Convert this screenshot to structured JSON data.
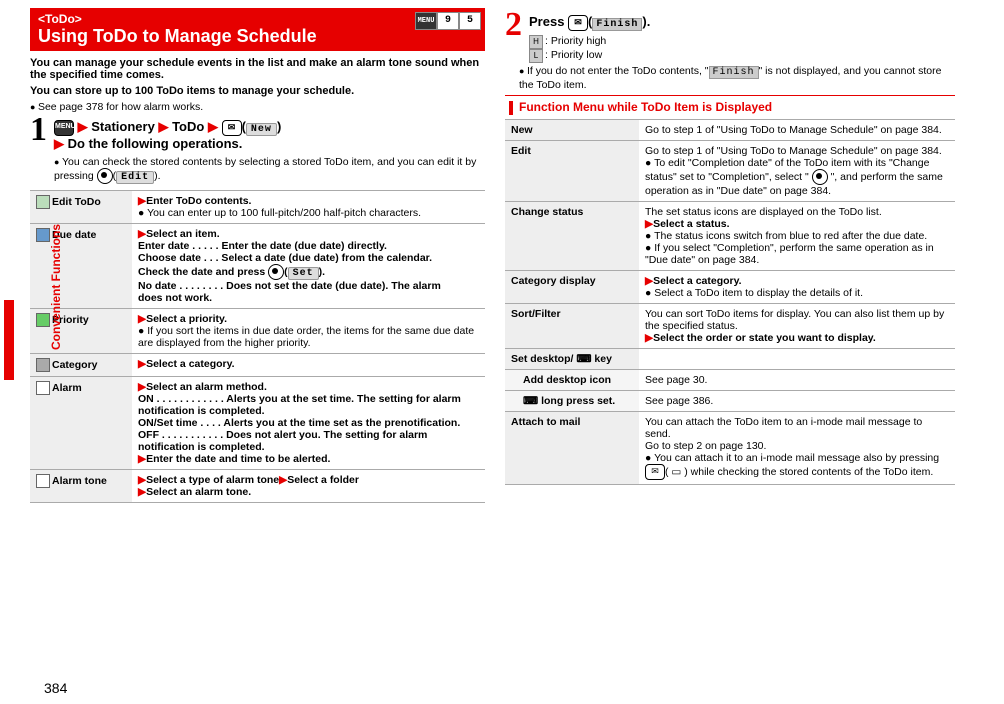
{
  "pageNumber": "384",
  "sideTab": "Convenient Functions",
  "header": {
    "kicker": "<ToDo>",
    "title": "Using ToDo to Manage Schedule",
    "badges": [
      "MENU",
      "9",
      "5"
    ]
  },
  "lead": [
    "You can manage your schedule events in the list and make an alarm tone sound when the specified time comes.",
    "You can store up to 100 ToDo items to manage your schedule."
  ],
  "leadBullet": "See page 378 for how alarm works.",
  "step1": {
    "num": "1",
    "parts": [
      "Stationery",
      "ToDo"
    ],
    "menuIcon": "MENU",
    "mailIcon": "✉",
    "newLabel": " New ",
    "end": "Do the following operations.",
    "note": "You can check the stored contents by selecting a stored ToDo item, and you can edit it by pressing ",
    "editLabel": " Edit "
  },
  "props": [
    {
      "key": "Edit ToDo",
      "iconBg": "#bdb",
      "body": "▶Enter ToDo contents.\n● You can enter up to 100 full-pitch/200 half-pitch characters."
    },
    {
      "key": "Due date",
      "iconBg": "#69c",
      "body": "▶Select an item.\nEnter date  . . . . . Enter the date (due date) directly.\nChoose date  . . . Select a date (due date) from the calendar.\n                             Check the date and press ⬤( Set ).\nNo date . . . . . . . . Does not set the date (due date). The alarm\n                             does not work."
    },
    {
      "key": "Priority",
      "iconBg": "#6c6",
      "body": "▶Select a priority.\n● If you sort the items in due date order, the items for the same due date are displayed from the higher priority."
    },
    {
      "key": "Category",
      "iconBg": "#aaa",
      "body": "▶Select a category."
    },
    {
      "key": "Alarm",
      "iconBg": "#fff",
      "body": "▶Select an alarm method.\nON . . . . . . . . . . . . Alerts you at the set time. The setting for alarm\n                             notification is completed.\nON/Set time . . . . Alerts you at the time set as the prenotification.\nOFF . . . . . . . . . . . Does not alert you. The setting for alarm\n                             notification is completed.\n▶Enter the date and time to be alerted."
    },
    {
      "key": "Alarm tone",
      "iconBg": "#fff",
      "body": "▶Select a type of alarm tone▶Select a folder\n▶Select an alarm tone."
    }
  ],
  "step2": {
    "num": "2",
    "press": "Press ",
    "finishLabel": "Finish",
    "priorityHigh": ": Priority high",
    "priorityLow": ": Priority low",
    "bullet": "If you do not enter the ToDo contents, \"",
    "bulletEnd": "\" is not displayed, and you cannot store the ToDo item."
  },
  "funcMenu": {
    "title": "Function Menu while ToDo Item is Displayed",
    "rows": [
      {
        "k": "New",
        "v": "Go to step 1 of \"Using ToDo to Manage Schedule\" on page 384."
      },
      {
        "k": "Edit",
        "v": "Go to step 1 of \"Using ToDo to Manage Schedule\" on page 384.\n● To edit \"Completion date\" of the ToDo item with its \"Change status\" set to \"Completion\", select \" ⬤ \", and perform the same operation as in \"Due date\" on page 384."
      },
      {
        "k": "Change status",
        "v": "The set status icons are displayed on the ToDo list.\n▶Select a status.\n● The status icons switch from blue to red after the due date.\n● If you select \"Completion\", perform the same operation as in \"Due date\" on page 384."
      },
      {
        "k": "Category display",
        "v": "▶Select a category.\n● Select a ToDo item to display the details of it."
      },
      {
        "k": "Sort/Filter",
        "v": "You can sort ToDo items for display. You can also list them up by the specified status.\n▶Select the order or state you want to display."
      },
      {
        "k": "Set desktop/ ⌨ key",
        "v": ""
      },
      {
        "k": "Add desktop icon",
        "v": "See page 30.",
        "indent": true
      },
      {
        "k": "⌨ long press set.",
        "v": "See page 386.",
        "indent": true
      },
      {
        "k": "Attach to mail",
        "v": "You can attach the ToDo item to an i-mode mail message to send.\nGo to step 2 on page 130.\n● You can attach it to an i-mode mail message also by pressing ✉( ▭ ) while checking the stored contents of the ToDo item."
      }
    ]
  }
}
